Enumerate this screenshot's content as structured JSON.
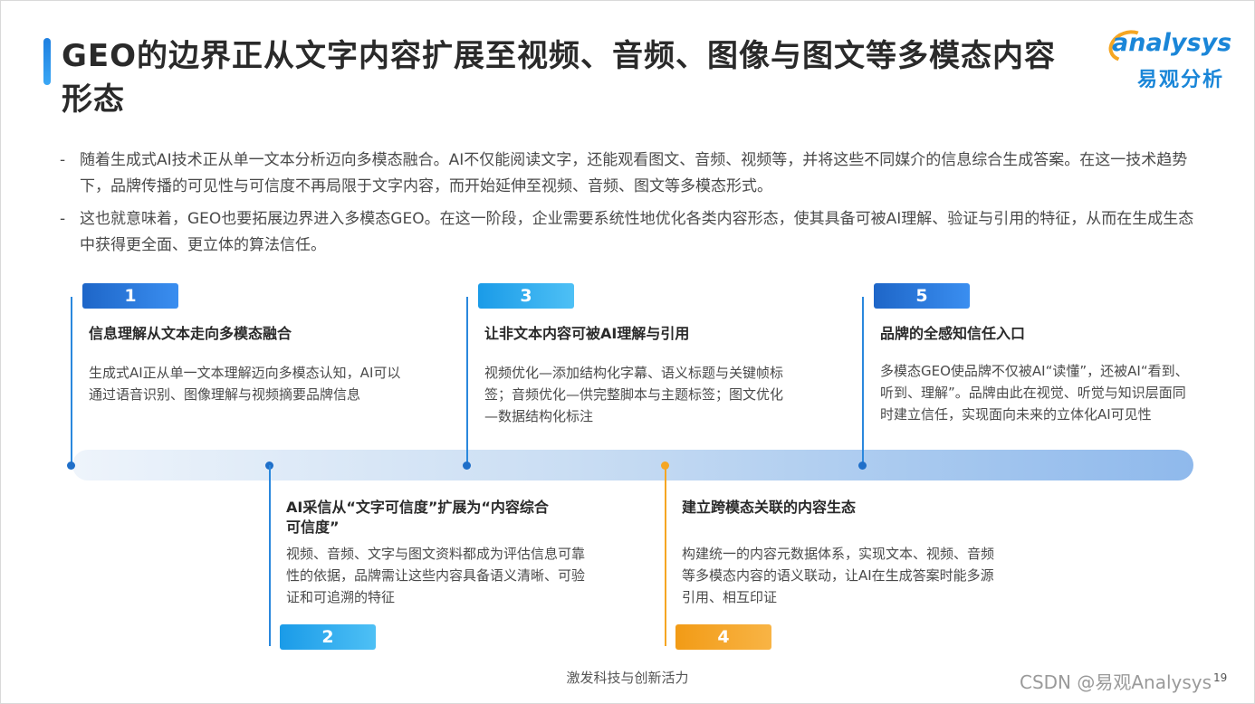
{
  "title": "GEO的边界正从文字内容扩展至视频、音频、图像与图文等多模态内容形态",
  "logo": {
    "en": "analysys",
    "cn": "易观分析"
  },
  "bullets": [
    {
      "dash": "-",
      "text": "随着生成式AI技术正从单一文本分析迈向多模态融合。AI不仅能阅读文字，还能观看图文、音频、视频等，并将这些不同媒介的信息综合生成答案。在这一技术趋势下，品牌传播的可见性与可信度不再局限于文字内容，而开始延伸至视频、音频、图文等多模态形式。"
    },
    {
      "dash": "-",
      "text": "这也就意味着，GEO也要拓展边界进入多模态GEO。在这一阶段，企业需要系统性地优化各类内容形态，使其具备可被AI理解、验证与引用的特征，从而在生成生态中获得更全面、更立体的算法信任。"
    }
  ],
  "steps": [
    {
      "num": "1",
      "title": "信息理解从文本走向多模态融合",
      "desc": "生成式AI正从单一文本理解迈向多模态认知，AI可以通过语音识别、图像理解与视频摘要品牌信息"
    },
    {
      "num": "2",
      "title": "AI采信从“文字可信度”扩展为“内容综合可信度”",
      "desc": "视频、音频、文字与图文资料都成为评估信息可靠性的依据，品牌需让这些内容具备语义清晰、可验证和可追溯的特征"
    },
    {
      "num": "3",
      "title": "让非文本内容可被AI理解与引用",
      "desc": "视频优化—添加结构化字幕、语义标题与关键帧标签；音频优化—供完整脚本与主题标签；图文优化—数据结构化标注"
    },
    {
      "num": "4",
      "title": "建立跨模态关联的内容生态",
      "desc": "构建统一的内容元数据体系，实现文本、视频、音频等多模态内容的语义联动，让AI在生成答案时能多源引用、相互印证"
    },
    {
      "num": "5",
      "title": "品牌的全感知信任入口",
      "desc": "多模态GEO使品牌不仅被AI“读懂”，还被AI“看到、听到、理解”。品牌由此在视觉、听觉与知识层面同时建立信任，实现面向未来的立体化AI可见性"
    }
  ],
  "footer": "激发科技与创新活力",
  "page_number": "19",
  "watermark": "CSDN @易观Analysys",
  "colors": {
    "accent_blue": "#1e7fe0",
    "accent_orange": "#f5a623"
  }
}
